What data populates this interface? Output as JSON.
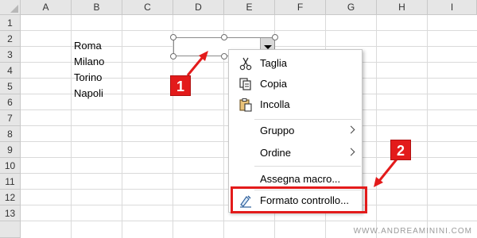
{
  "sheet": {
    "columns": [
      "A",
      "B",
      "C",
      "D",
      "E",
      "F",
      "G",
      "H",
      "I"
    ],
    "rows": [
      "1",
      "2",
      "3",
      "4",
      "5",
      "6",
      "7",
      "8",
      "9",
      "10",
      "11",
      "12",
      "13"
    ],
    "cells": [
      {
        "ref": "B2",
        "value": "Roma"
      },
      {
        "ref": "B3",
        "value": "Milano"
      },
      {
        "ref": "B4",
        "value": "Torino"
      },
      {
        "ref": "B5",
        "value": "Napoli"
      }
    ]
  },
  "context_menu": {
    "items": [
      {
        "label": "Taglia",
        "icon": "scissors-icon"
      },
      {
        "label": "Copia",
        "icon": "copy-icon"
      },
      {
        "label": "Incolla",
        "icon": "paste-icon"
      },
      {
        "label": "Gruppo",
        "has_submenu": true
      },
      {
        "label": "Ordine",
        "has_submenu": true
      },
      {
        "label": "Assegna macro..."
      },
      {
        "label": "Formato controllo...",
        "icon": "format-control-icon"
      }
    ]
  },
  "callouts": [
    {
      "label": "1",
      "color": "#e31b1b"
    },
    {
      "label": "2",
      "color": "#e31b1b"
    }
  ],
  "watermark": "WWW.ANDREAMININI.COM",
  "colors": {
    "accent": "#e31b1b",
    "header_bg": "#e6e6e6",
    "gridline": "#dadada"
  }
}
